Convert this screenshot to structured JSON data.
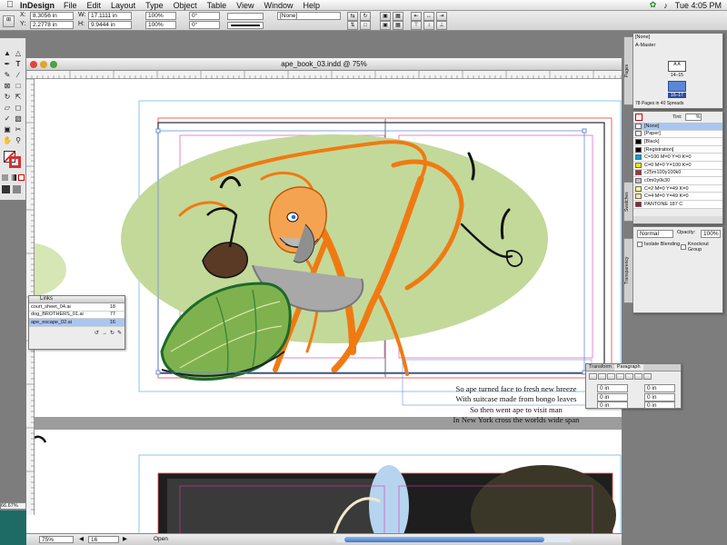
{
  "menubar": {
    "app_name": "InDesign",
    "menus": [
      "File",
      "Edit",
      "Layout",
      "Type",
      "Object",
      "Table",
      "View",
      "Window",
      "Help"
    ],
    "clock": "Tue 4:05 PM"
  },
  "control": {
    "x_label": "X:",
    "x_value": "8.3056 in",
    "y_label": "Y:",
    "y_value": "2.2778 in",
    "w_label": "W:",
    "w_value": "17.1111 in",
    "h_label": "H:",
    "h_value": "9.9444 in",
    "scale_x": "100%",
    "scale_y": "100%",
    "rotation": "0°",
    "shear": "0°",
    "stroke_style": "[None]"
  },
  "document": {
    "title": "ape_book_03.indd @ 75%",
    "verse": [
      "So ape turned face to fresh new breeze",
      "With suitcase made from bongo leaves",
      "So then went ape to visit man",
      "In New York cross the worlds wide span"
    ],
    "zoom": "75%",
    "page": "16",
    "status": "Open",
    "view_zoom": "66.67%"
  },
  "links": {
    "title": "Links",
    "items": [
      {
        "name": "court_sheet_04.ai",
        "page": "18"
      },
      {
        "name": "dog_BROTHERS_01.ai",
        "page": "77"
      },
      {
        "name": "ape_escape_02.ai",
        "page": "16"
      }
    ]
  },
  "pages": {
    "tab": "Pages",
    "none": "[None]",
    "master": "A-Master",
    "spread1": "14–15",
    "spread2": "16–17",
    "footer": "78 Pages in 40 Spreads"
  },
  "swatches": {
    "tab": "Swatches",
    "tint_label": "Tint:",
    "tint_value": "%",
    "items": [
      {
        "name": "[None]",
        "color": "#ffffff"
      },
      {
        "name": "[Paper]",
        "color": "#ffffff"
      },
      {
        "name": "[Black]",
        "color": "#000000"
      },
      {
        "name": "[Registration]",
        "color": "#000000"
      },
      {
        "name": "C=100 M=0 Y=0 K=0",
        "color": "#00a0e6"
      },
      {
        "name": "C=0 M=0 Y=100 K=0",
        "color": "#ffe600"
      },
      {
        "name": "c25m100y100k0",
        "color": "#c0282d"
      },
      {
        "name": "c0m0y0k30",
        "color": "#bcbcbc"
      },
      {
        "name": "C=2 M=0 Y=49 K=0",
        "color": "#fbf48f"
      },
      {
        "name": "C=4 M=0 Y=49 K=0",
        "color": "#f8f08a"
      },
      {
        "name": "PANTONE 187 C",
        "color": "#a6192e"
      }
    ]
  },
  "transparency": {
    "tab": "Transparency",
    "mode": "Normal",
    "opacity_label": "Opacity:",
    "opacity_value": "100%",
    "isolate": "Isolate Blending",
    "knockout": "Knockout Group"
  },
  "paragraph": {
    "tab_transform": "Transform",
    "tab_paragraph": "Paragraph",
    "values": [
      "0 in",
      "0 in",
      "0 in",
      "0 in",
      "0 in",
      "0 in"
    ]
  },
  "colors": {
    "green_wash": "#c3d99a",
    "ape_orange": "#f07a12",
    "bag_green": "#3c8a3c",
    "guide_magenta": "#d43aa8",
    "bleed_red": "#e54040",
    "selection": "#6a8fd8"
  }
}
